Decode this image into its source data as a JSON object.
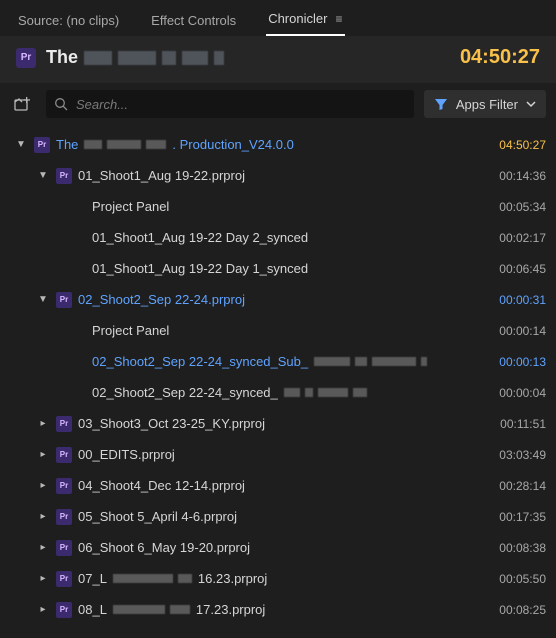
{
  "tabs": {
    "source": "Source: (no clips)",
    "effects": "Effect Controls",
    "chronicler": "Chronicler"
  },
  "header": {
    "title_prefix": "The",
    "total_time": "04:50:27"
  },
  "toolbar": {
    "search_placeholder": "Search...",
    "filter_label": "Apps Filter"
  },
  "tree": {
    "root": {
      "label_prefix": "The",
      "label_suffix": ". Production_V24.0.0",
      "time": "04:50:27"
    },
    "items": [
      {
        "indent": 2,
        "chev": "down",
        "icon": "pr",
        "label": "01_Shoot1_Aug 19-22.prproj",
        "time": "00:14:36"
      },
      {
        "indent": 3,
        "label": "Project Panel",
        "time": "00:05:34"
      },
      {
        "indent": 3,
        "label": "01_Shoot1_Aug 19-22 Day 2_synced",
        "time": "00:02:17"
      },
      {
        "indent": 3,
        "label": "01_Shoot1_Aug 19-22 Day 1_synced",
        "time": "00:06:45"
      },
      {
        "indent": 2,
        "chev": "down",
        "icon": "pr",
        "label": "02_Shoot2_Sep 22-24.prproj",
        "time": "00:00:31",
        "sel": true
      },
      {
        "indent": 3,
        "label": "Project Panel",
        "time": "00:00:14"
      },
      {
        "indent": 3,
        "label": "02_Shoot2_Sep 22-24_synced_Sub_",
        "time": "00:00:13",
        "sel": true,
        "redact": [
          36,
          12,
          44,
          6
        ]
      },
      {
        "indent": 3,
        "label": "02_Shoot2_Sep 22-24_synced_",
        "time": "00:00:04",
        "redact": [
          16,
          8,
          30,
          14
        ]
      },
      {
        "indent": 2,
        "chev": "right",
        "icon": "pr",
        "label": "03_Shoot3_Oct 23-25_KY.prproj",
        "time": "00:11:51"
      },
      {
        "indent": 2,
        "chev": "right",
        "icon": "pr",
        "label": "00_EDITS.prproj",
        "time": "03:03:49"
      },
      {
        "indent": 2,
        "chev": "right",
        "icon": "pr",
        "label": "04_Shoot4_Dec 12-14.prproj",
        "time": "00:28:14"
      },
      {
        "indent": 2,
        "chev": "right",
        "icon": "pr",
        "label": "05_Shoot 5_April 4-6.prproj",
        "time": "00:17:35"
      },
      {
        "indent": 2,
        "chev": "right",
        "icon": "pr",
        "label": "06_Shoot 6_May 19-20.prproj",
        "time": "00:08:38"
      },
      {
        "indent": 2,
        "chev": "right",
        "icon": "pr",
        "label": "07_L",
        "label_suffix": "16.23.prproj",
        "time": "00:05:50",
        "redact": [
          60,
          14
        ]
      },
      {
        "indent": 2,
        "chev": "right",
        "icon": "pr",
        "label": "08_L",
        "label_suffix": "17.23.prproj",
        "time": "00:08:25",
        "redact": [
          52,
          20
        ]
      }
    ]
  }
}
